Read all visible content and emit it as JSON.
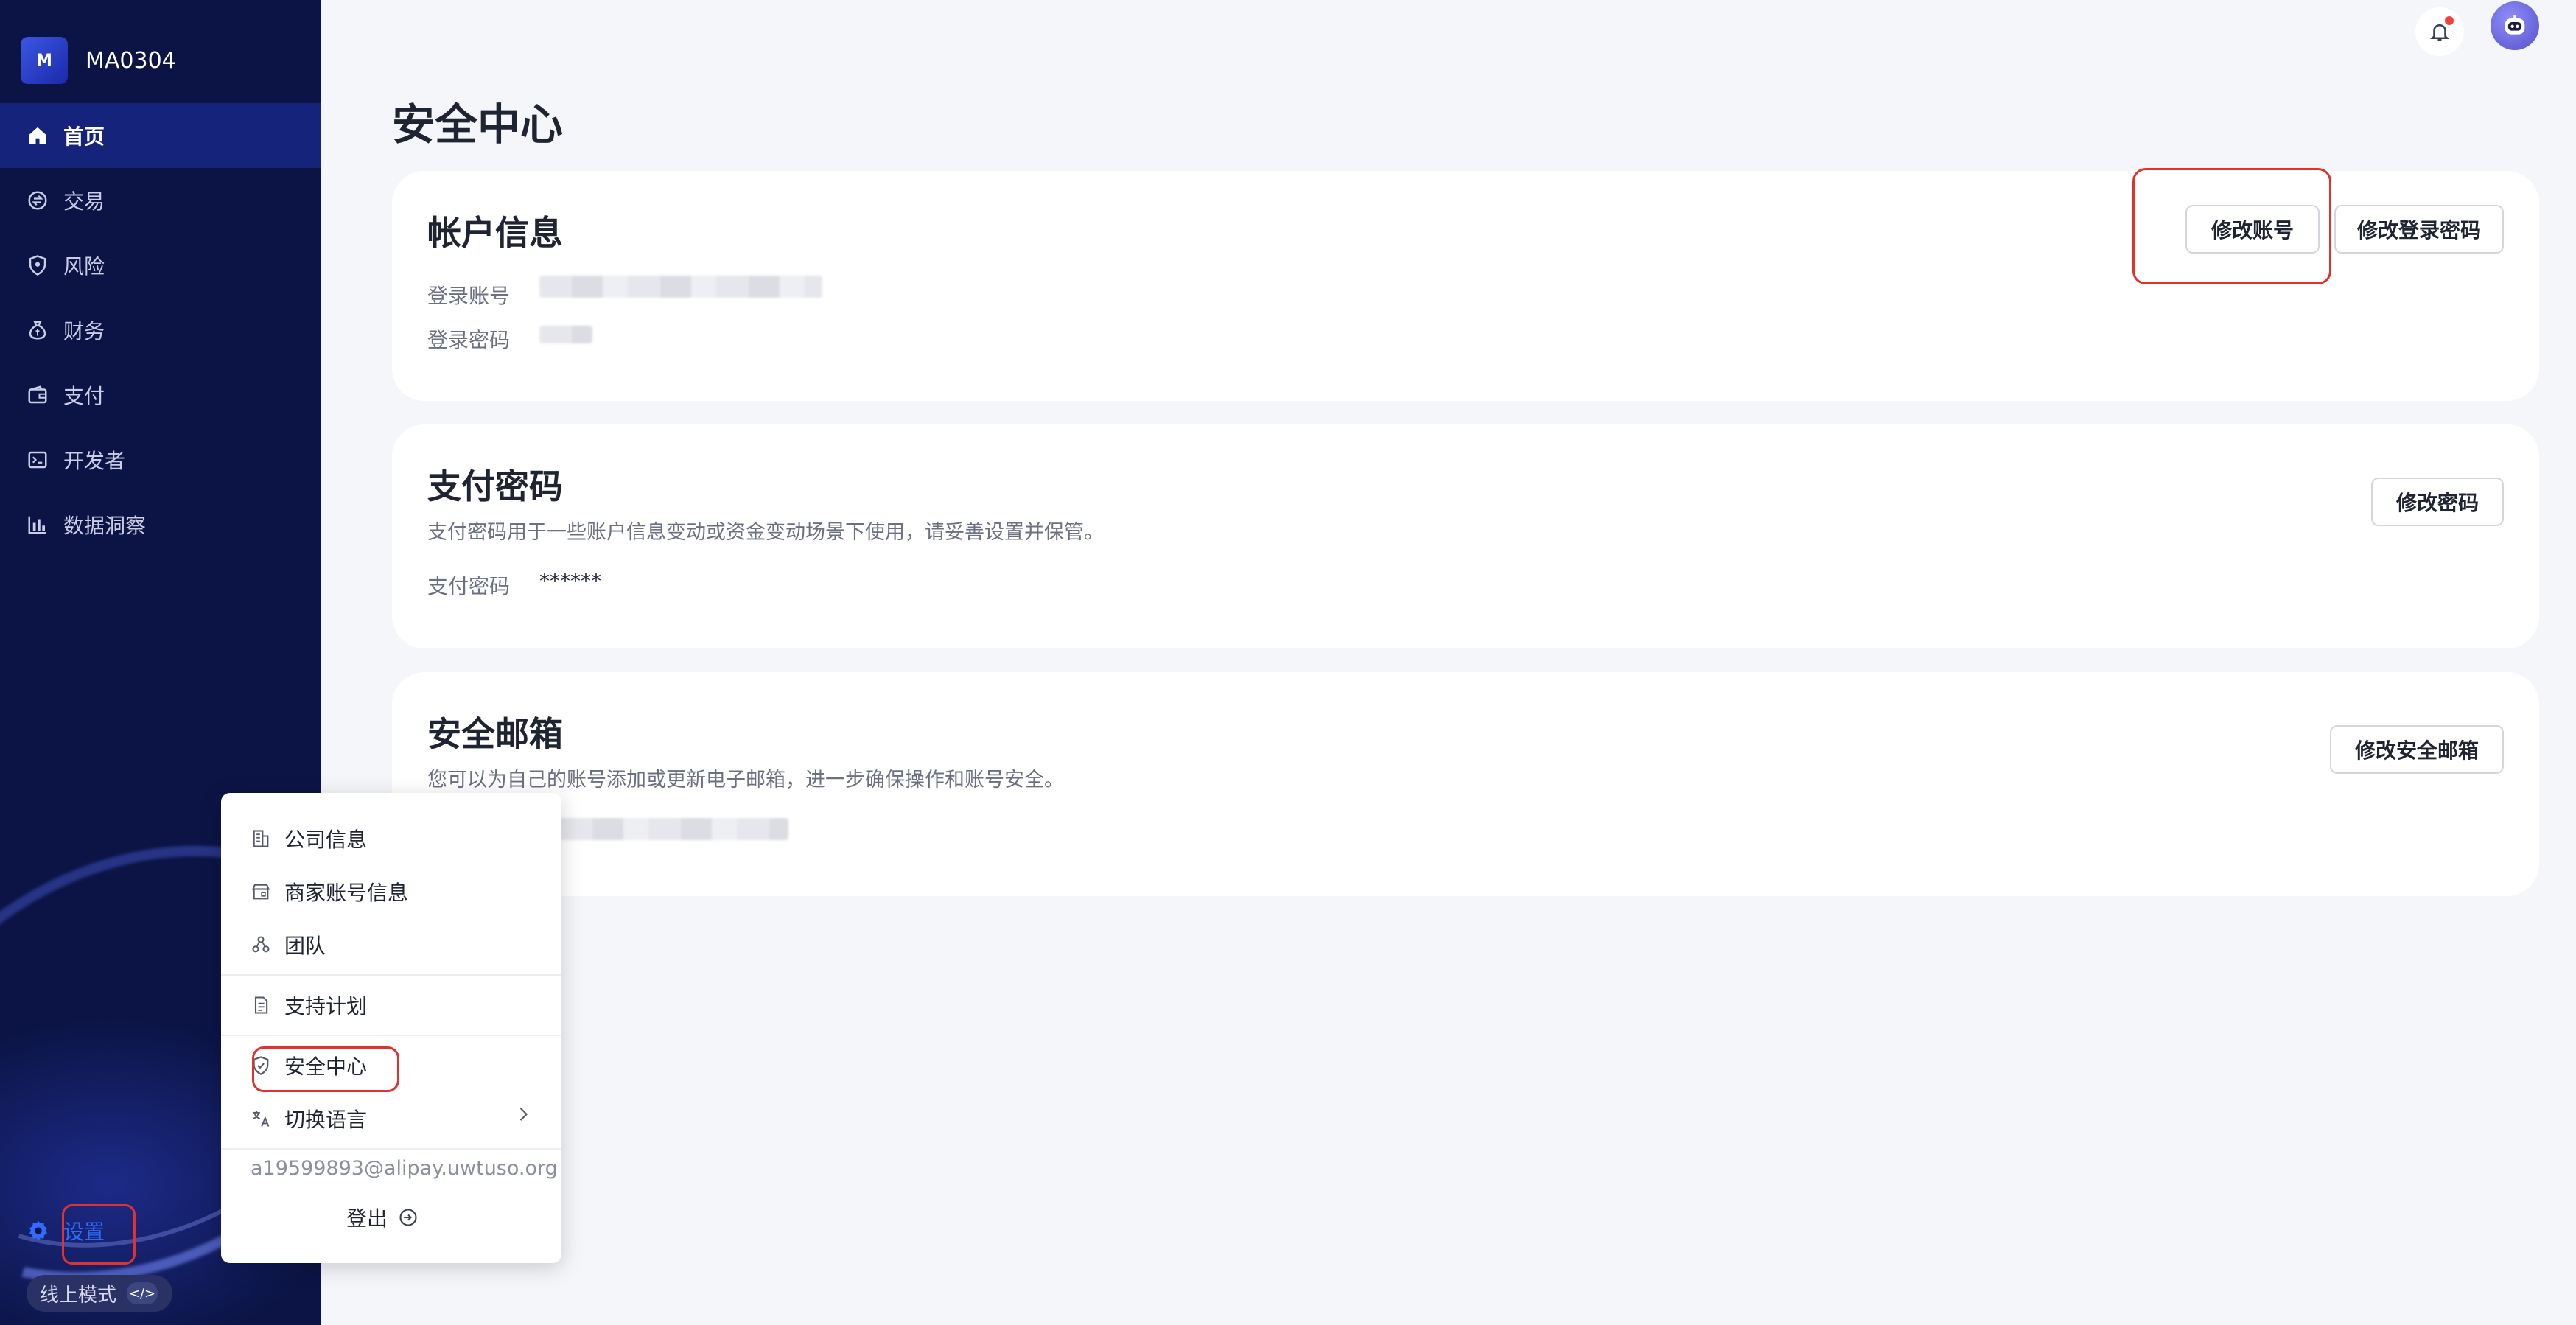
{
  "brand": {
    "logo_letter": "M",
    "name": "MA0304"
  },
  "nav": {
    "items": [
      {
        "label": "首页",
        "icon": "home-icon",
        "active": true
      },
      {
        "label": "交易",
        "icon": "transaction-icon"
      },
      {
        "label": "风险",
        "icon": "shield-icon"
      },
      {
        "label": "财务",
        "icon": "money-icon"
      },
      {
        "label": "支付",
        "icon": "wallet-icon"
      },
      {
        "label": "开发者",
        "icon": "terminal-icon"
      },
      {
        "label": "数据洞察",
        "icon": "bar-chart-icon"
      }
    ],
    "settings_label": "设置",
    "mode_label": "线上模式",
    "mode_code": "</>"
  },
  "page": {
    "title": "安全中心"
  },
  "account_card": {
    "title": "帐户信息",
    "login_account_label": "登录账号",
    "login_password_label": "登录密码",
    "edit_account_button": "修改账号",
    "edit_password_button": "修改登录密码"
  },
  "payment_card": {
    "title": "支付密码",
    "description": "支付密码用于一些账户信息变动或资金变动场景下使用，请妥善设置并保管。",
    "password_label": "支付密码",
    "password_value": "******",
    "edit_button": "修改密码"
  },
  "email_card": {
    "title": "安全邮箱",
    "description": "您可以为自己的账号添加或更新电子邮箱，进一步确保操作和账号安全。",
    "edit_button": "修改安全邮箱"
  },
  "menu": {
    "items": {
      "company": "公司信息",
      "merchant": "商家账号信息",
      "team": "团队",
      "support": "支持计划",
      "security": "安全中心",
      "language": "切换语言"
    },
    "email": "a19599893@alipay.uwtuso.org",
    "logout": "登出"
  },
  "colors": {
    "sidebar_bg": "#0b1444",
    "sidebar_active": "#15237a",
    "accent": "#2f6bff",
    "annotation_red": "#e0332f",
    "notification_dot": "#f2403a"
  }
}
